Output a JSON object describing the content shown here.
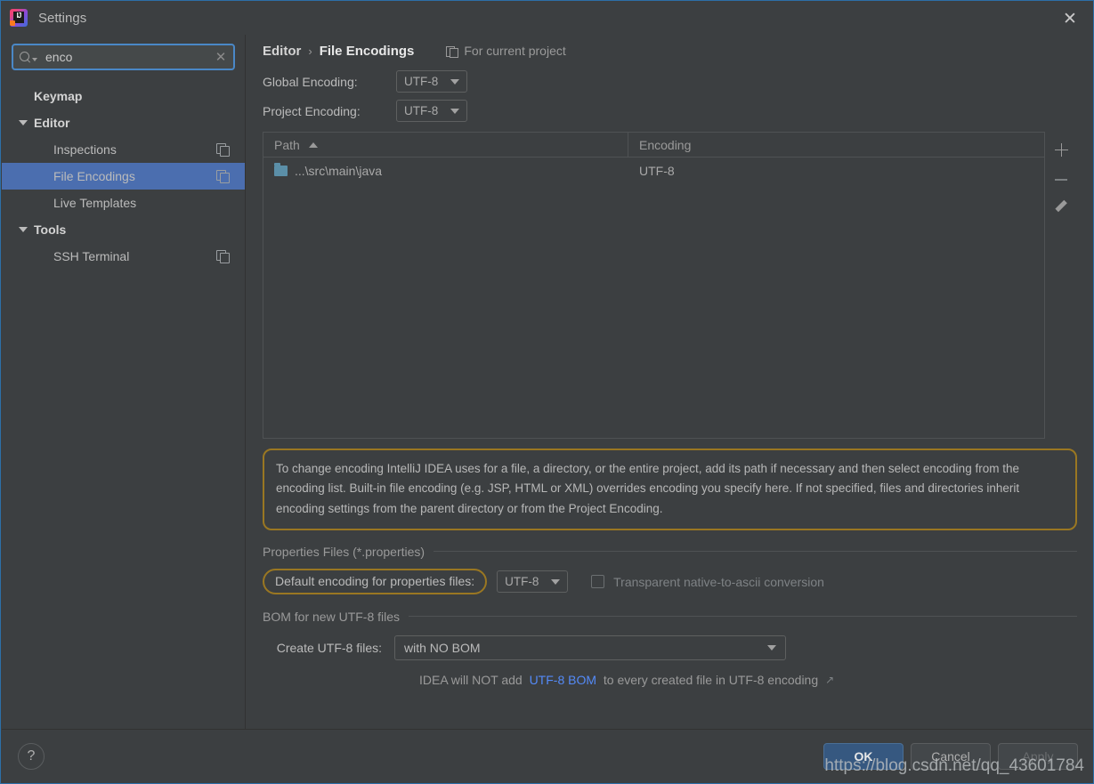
{
  "window": {
    "title": "Settings",
    "logo_icon": "intellij-idea-logo",
    "close_icon": "close-icon"
  },
  "search": {
    "value": "enco",
    "placeholder": "Search settings",
    "search_icon": "search-icon",
    "clear_icon": "clear-icon"
  },
  "sidebar": {
    "items": [
      {
        "label": "Keymap",
        "type": "group",
        "indent": 0,
        "expanded": false,
        "arrow": false,
        "copy_icon": false,
        "selected": false
      },
      {
        "label": "Editor",
        "type": "group",
        "indent": 0,
        "expanded": true,
        "arrow": true,
        "copy_icon": false,
        "selected": false
      },
      {
        "label": "Inspections",
        "type": "leaf",
        "indent": 1,
        "expanded": false,
        "arrow": false,
        "copy_icon": true,
        "selected": false
      },
      {
        "label": "File Encodings",
        "type": "leaf",
        "indent": 1,
        "expanded": false,
        "arrow": false,
        "copy_icon": true,
        "selected": true
      },
      {
        "label": "Live Templates",
        "type": "leaf",
        "indent": 1,
        "expanded": false,
        "arrow": false,
        "copy_icon": false,
        "selected": false
      },
      {
        "label": "Tools",
        "type": "group",
        "indent": 0,
        "expanded": true,
        "arrow": true,
        "copy_icon": false,
        "selected": false
      },
      {
        "label": "SSH Terminal",
        "type": "leaf",
        "indent": 1,
        "expanded": false,
        "arrow": false,
        "copy_icon": true,
        "selected": false
      }
    ]
  },
  "breadcrumb": {
    "parent": "Editor",
    "separator": "›",
    "current": "File Encodings",
    "scope_label": "For current project",
    "scope_icon": "project-scope-icon"
  },
  "encoding": {
    "global_label": "Global Encoding:",
    "global_value": "UTF-8",
    "project_label": "Project Encoding:",
    "project_value": "UTF-8"
  },
  "table": {
    "columns": [
      "Path",
      "Encoding"
    ],
    "sort_column": "Path",
    "sort_direction": "asc",
    "rows": [
      {
        "path": "...\\src\\main\\java",
        "encoding": "UTF-8",
        "icon": "folder-icon"
      }
    ],
    "side_buttons": [
      {
        "name": "add-button",
        "icon": "plus-icon",
        "enabled": true
      },
      {
        "name": "remove-button",
        "icon": "minus-icon",
        "enabled": false
      },
      {
        "name": "edit-button",
        "icon": "pencil-icon",
        "enabled": true
      }
    ]
  },
  "tip": {
    "text": "To change encoding IntelliJ IDEA uses for a file, a directory, or the entire project, add its path if necessary and then select encoding from the encoding list. Built-in file encoding (e.g. JSP, HTML or XML) overrides encoding you specify here. If not specified, files and directories inherit encoding settings from the parent directory or from the Project Encoding."
  },
  "properties_section": {
    "title": "Properties Files (*.properties)",
    "default_encoding_label": "Default encoding for properties files:",
    "default_encoding_value": "UTF-8",
    "checkbox_label": "Transparent native-to-ascii conversion",
    "checkbox_checked": false,
    "checkbox_enabled": false
  },
  "bom_section": {
    "title": "BOM for new UTF-8 files",
    "create_label": "Create UTF-8 files:",
    "create_value": "with NO BOM",
    "note_prefix": "IDEA will NOT add",
    "note_link": "UTF-8 BOM",
    "note_suffix": "to every created file in UTF-8 encoding",
    "external_link_icon": "↗"
  },
  "footer": {
    "help_label": "?",
    "ok_label": "OK",
    "cancel_label": "Cancel",
    "apply_label": "Apply",
    "apply_enabled": false
  },
  "watermark": {
    "text": "https://blog.csdn.net/qq_43601784"
  },
  "colors": {
    "background": "#3c3f41",
    "selection": "#4b6eaf",
    "accent_highlight": "#9a7722",
    "primary_button": "#365880",
    "link": "#548af7",
    "folder": "#5b8fa8"
  }
}
